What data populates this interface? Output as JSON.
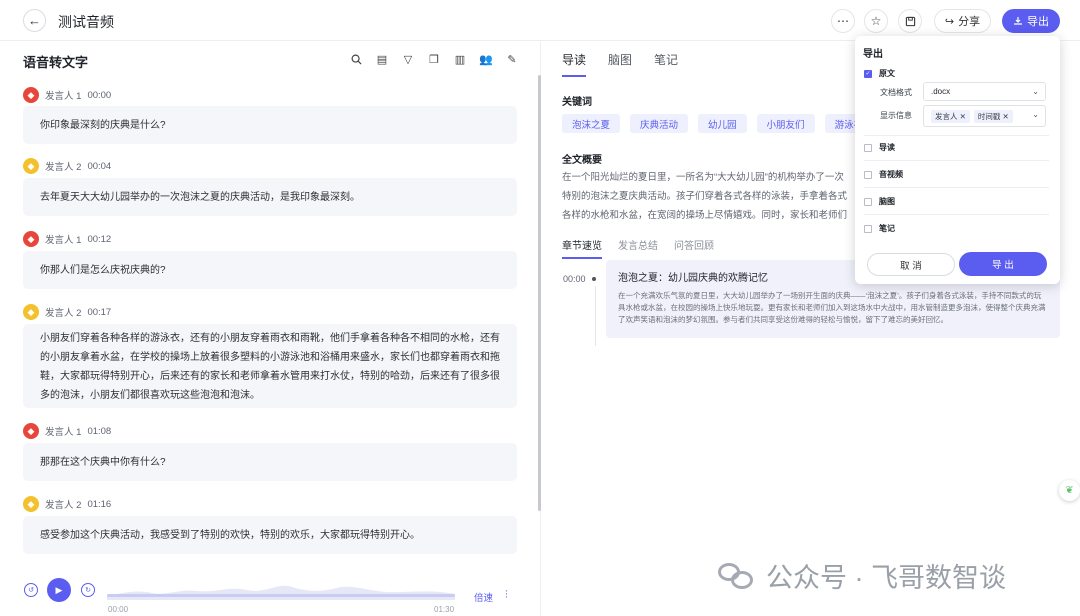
{
  "header": {
    "title": "测试音频",
    "share_label": "分享",
    "export_label": "导出"
  },
  "left": {
    "title": "语音转文字",
    "transcript": [
      {
        "speaker": "发言人 1",
        "time": "00:00",
        "avatar": "red",
        "text": "你印象最深刻的庆典是什么?"
      },
      {
        "speaker": "发言人 2",
        "time": "00:04",
        "avatar": "yellow",
        "text": "去年夏天大大幼儿园举办的一次泡沫之夏的庆典活动，是我印象最深刻。"
      },
      {
        "speaker": "发言人 1",
        "time": "00:12",
        "avatar": "red",
        "text": "你那人们是怎么庆祝庆典的?"
      },
      {
        "speaker": "发言人 2",
        "time": "00:17",
        "avatar": "yellow",
        "text": "小朋友们穿着各种各样的游泳衣，还有的小朋友穿着雨衣和雨靴，他们手拿着各种各不相同的水枪，还有的小朋友拿着水盆，在学校的操场上放着很多塑料的小游泳池和浴桶用来盛水，家长们也都穿着雨衣和拖鞋，大家都玩得特别开心，后来还有的家长和老师拿着水管用来打水仗，特别的哈劲，后来还有了很多很多的泡沫，小朋友们都很喜欢玩这些泡泡和泡沫。"
      },
      {
        "speaker": "发言人 1",
        "time": "01:08",
        "avatar": "red",
        "text": "那那在这个庆典中你有什么?"
      },
      {
        "speaker": "发言人 2",
        "time": "01:16",
        "avatar": "yellow",
        "text": "感受参加这个庆典活动，我感受到了特别的欢快，特别的欢乐，大家都玩得特别开心。"
      }
    ],
    "player": {
      "time_start": "00:00",
      "time_end": "01:30",
      "speed_label": "倍速",
      "progress": 0
    }
  },
  "right": {
    "tabs": [
      "导读",
      "脑图",
      "笔记"
    ],
    "keywords_title": "关键词",
    "keywords": [
      "泡沫之夏",
      "庆典活动",
      "幼儿园",
      "小朋友们",
      "游泳衣"
    ],
    "summary_title": "全文概要",
    "summary_text": "在一个阳光灿烂的夏日里，一所名为“大大幼儿园”的机构举办了一次特别的泡沫之夏庆典活动。孩子们穿着各式各样的泳装，手拿着各式各样的水枪和水盆，在宽阔的操场上尽情嬉戏。同时，家长和老师们也积极参与，穿着雨衣加入到这场水中大战中，利用水管喷射出更多的泡沫，使得现场充满了无尽的欢笑声和梦幻般的泡泡景象。",
    "subtabs": [
      "章节速览",
      "发言总结",
      "问答回顾"
    ],
    "chapter": {
      "time": "00:00",
      "title": "泡泡之夏：幼儿园庆典的欢腾记忆",
      "text": "在一个充满欢乐气氛的夏日里，大大幼儿园举办了一场别开生面的庆典——‘泡沫之夏’。孩子们身着各式泳装，手持不同款式的玩具水枪或水盆，在校园的操场上快乐地玩耍。更有家长和老师们加入到这场水中大战中，用水管制造更多泡沫，使得整个庆典充满了欢声笑语和泡沫的梦幻氛围。参与者们共同享受这份难得的轻松与愉悦，留下了难忘的美好回忆。"
    }
  },
  "export_popup": {
    "title": "导出",
    "original_label": "原文",
    "original_checked": true,
    "format_label": "文档格式",
    "format_value": ".docx",
    "display_label": "显示信息",
    "display_chips": [
      "发言人",
      "时间戳"
    ],
    "guide_label": "导读",
    "audio_label": "音视频",
    "mindmap_label": "脑图",
    "notes_label": "笔记",
    "cancel_label": "取 消",
    "confirm_label": "导 出"
  },
  "watermark": {
    "text": "公众号 · 飞哥数智谈"
  },
  "colors": {
    "accent": "#5b5cf0",
    "chip_bg": "#eef0fd",
    "bubble_bg": "#f5f6f9"
  }
}
